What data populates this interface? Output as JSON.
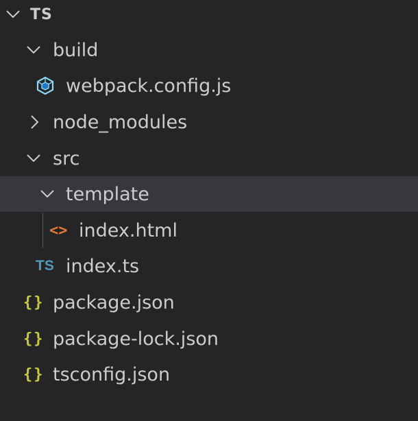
{
  "explorer": {
    "root": {
      "label": "TS",
      "expanded": true
    },
    "items": [
      {
        "label": "build",
        "type": "folder",
        "expanded": true
      },
      {
        "label": "webpack.config.js",
        "type": "file",
        "icon": "webpack-icon"
      },
      {
        "label": "node_modules",
        "type": "folder",
        "expanded": false
      },
      {
        "label": "src",
        "type": "folder",
        "expanded": true
      },
      {
        "label": "template",
        "type": "folder",
        "expanded": true,
        "selected": true
      },
      {
        "label": "index.html",
        "type": "file",
        "icon": "html-icon",
        "icon_text": "<>"
      },
      {
        "label": "index.ts",
        "type": "file",
        "icon": "typescript-icon",
        "icon_text": "TS"
      },
      {
        "label": "package.json",
        "type": "file",
        "icon": "json-icon",
        "icon_text": "{}"
      },
      {
        "label": "package-lock.json",
        "type": "file",
        "icon": "json-icon",
        "icon_text": "{}"
      },
      {
        "label": "tsconfig.json",
        "type": "file",
        "icon": "json-icon",
        "icon_text": "{}"
      }
    ]
  },
  "colors": {
    "background": "#252526",
    "selected_row": "#37373d",
    "text": "#cccccc",
    "json_icon": "#cbcb41",
    "ts_icon": "#519aba",
    "html_icon": "#e37933",
    "webpack_icon": "#8ed6fb"
  }
}
